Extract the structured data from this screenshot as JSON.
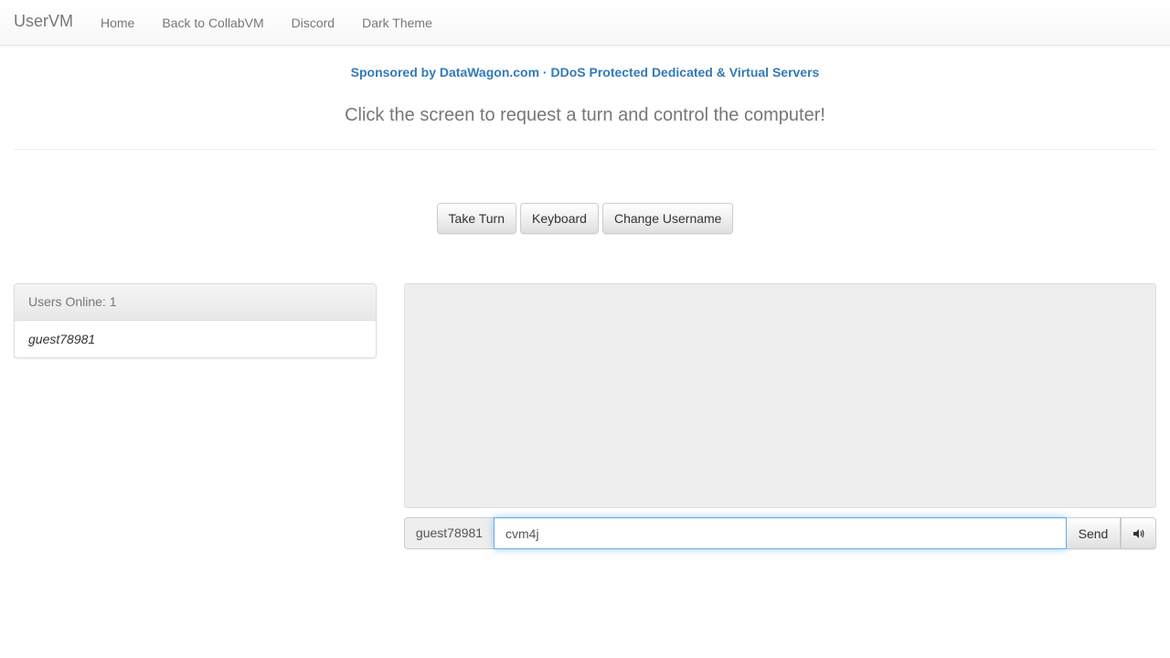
{
  "navbar": {
    "brand": "UserVM",
    "links": [
      "Home",
      "Back to CollabVM",
      "Discord",
      "Dark Theme"
    ]
  },
  "sponsor_text": "Sponsored by DataWagon.com · DDoS Protected Dedicated & Virtual Servers",
  "instruction": "Click the screen to request a turn and control the computer!",
  "buttons": {
    "take_turn": "Take Turn",
    "keyboard": "Keyboard",
    "change_username": "Change Username"
  },
  "users_panel": {
    "heading": "Users Online: 1",
    "users": [
      "guest78981"
    ]
  },
  "chat": {
    "username": "guest78981",
    "input_value": "cvm4j",
    "send_label": "Send",
    "sound_icon": "volume-icon"
  },
  "colors": {
    "link": "#337ab7",
    "muted": "#777777",
    "focus_border": "#66afe9",
    "panel_bg": "#eeeeee"
  }
}
